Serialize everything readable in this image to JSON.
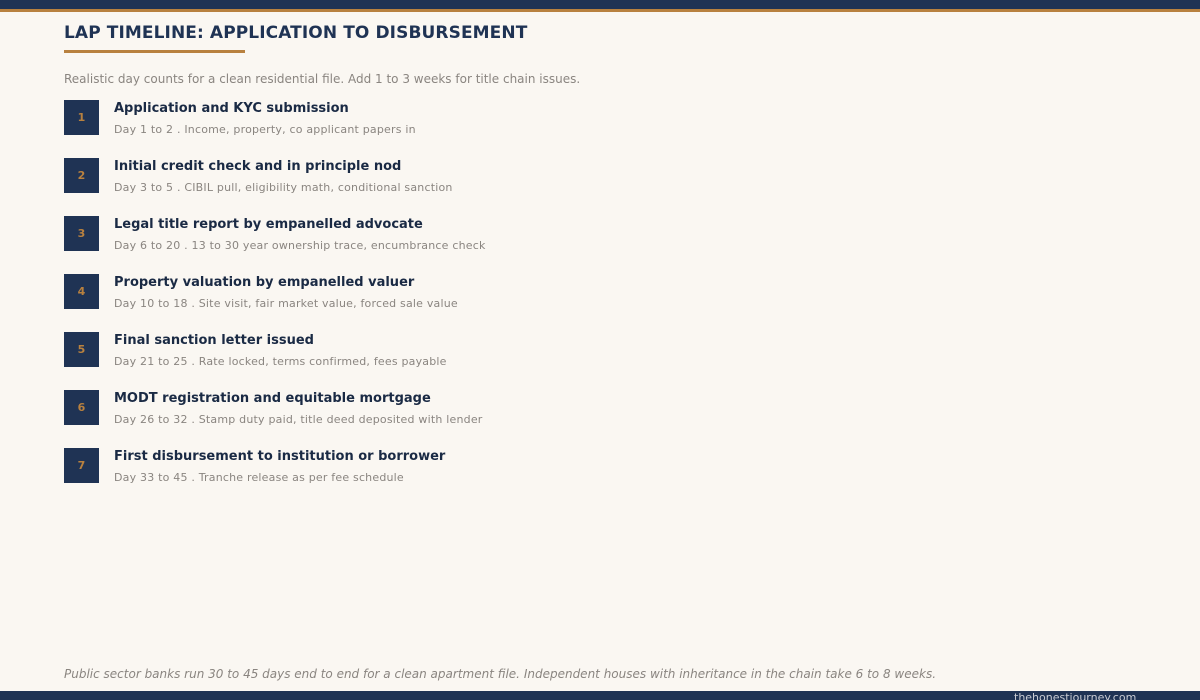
{
  "title": "LAP TIMELINE: APPLICATION TO DISBURSEMENT",
  "subtitle": "Realistic day counts for a clean residential file. Add 1 to 3 weeks for title chain issues.",
  "steps": [
    {
      "num": "1",
      "title": "Application and KYC submission",
      "desc": "Day 1 to 2  .  Income, property, co applicant papers in"
    },
    {
      "num": "2",
      "title": "Initial credit check and in principle nod",
      "desc": "Day 3 to 5  .  CIBIL pull, eligibility math, conditional sanction"
    },
    {
      "num": "3",
      "title": "Legal title report by empanelled advocate",
      "desc": "Day 6 to 20  .  13 to 30 year ownership trace, encumbrance check"
    },
    {
      "num": "4",
      "title": "Property valuation by empanelled valuer",
      "desc": "Day 10 to 18  .  Site visit, fair market value, forced sale value"
    },
    {
      "num": "5",
      "title": "Final sanction letter issued",
      "desc": "Day 21 to 25  .  Rate locked, terms confirmed, fees payable"
    },
    {
      "num": "6",
      "title": "MODT registration and equitable mortgage",
      "desc": "Day 26 to 32  .  Stamp duty paid, title deed deposited with lender"
    },
    {
      "num": "7",
      "title": "First disbursement to institution or borrower",
      "desc": "Day 33 to 45  .  Tranche release as per fee schedule"
    }
  ],
  "footnote": "Public sector banks run 30 to 45 days end to end for a clean apartment file. Independent houses with inheritance in the chain take 6 to 8 weeks.",
  "brand": "thehonestjourney.com",
  "colors": {
    "navy": "#1f3354",
    "gold": "#b8813f",
    "background": "#faf7f2"
  }
}
